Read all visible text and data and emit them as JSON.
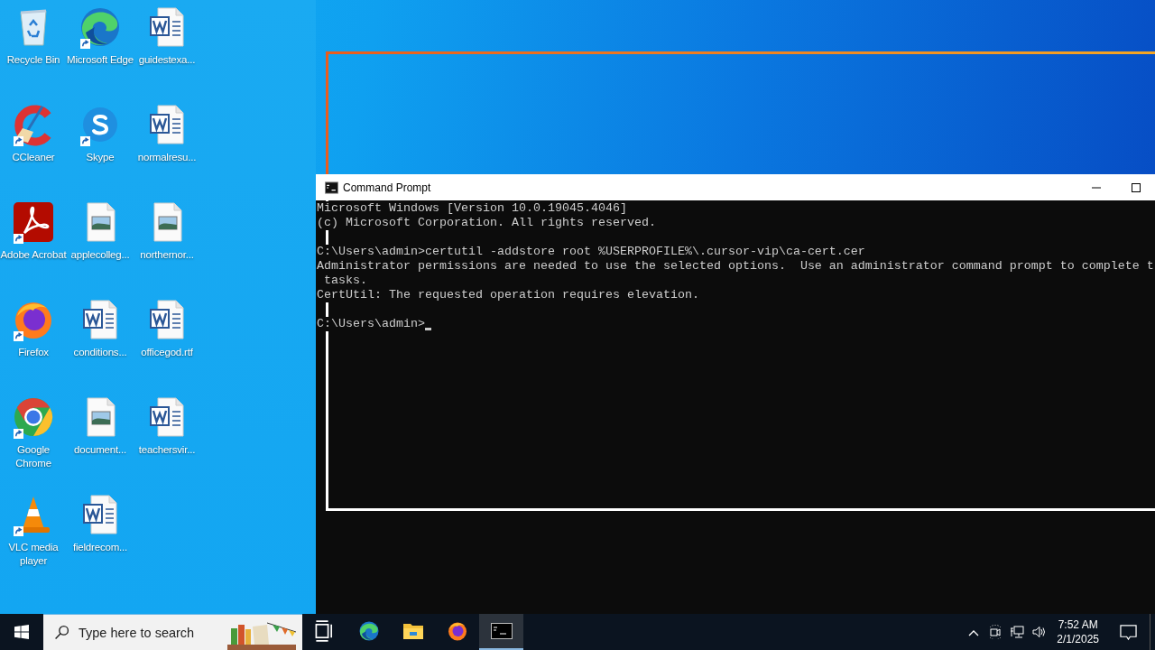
{
  "desktop": {
    "icons": [
      {
        "label": "Recycle Bin",
        "kind": "recycle-bin",
        "shortcut": false
      },
      {
        "label": "CCleaner",
        "kind": "ccleaner",
        "shortcut": true
      },
      {
        "label": "Adobe Acrobat",
        "kind": "acrobat",
        "shortcut": true
      },
      {
        "label": "Firefox",
        "kind": "firefox",
        "shortcut": true
      },
      {
        "label": "Google Chrome",
        "kind": "chrome",
        "shortcut": true
      },
      {
        "label": "VLC media player",
        "kind": "vlc",
        "shortcut": true
      },
      {
        "label": "Microsoft Edge",
        "kind": "edge",
        "shortcut": true
      },
      {
        "label": "Skype",
        "kind": "skype",
        "shortcut": true
      },
      {
        "label": "applecolleg...",
        "kind": "image-file",
        "shortcut": false
      },
      {
        "label": "conditions...",
        "kind": "word-file",
        "shortcut": false
      },
      {
        "label": "document...",
        "kind": "image-file",
        "shortcut": false
      },
      {
        "label": "fieldrecom...",
        "kind": "word-file",
        "shortcut": false
      },
      {
        "label": "guidestexa...",
        "kind": "word-file",
        "shortcut": false
      },
      {
        "label": "normalresu...",
        "kind": "word-file",
        "shortcut": false
      },
      {
        "label": "northernor...",
        "kind": "image-file",
        "shortcut": false
      },
      {
        "label": "officegod.rtf",
        "kind": "word-file",
        "shortcut": false
      },
      {
        "label": "teachersvir...",
        "kind": "word-file",
        "shortcut": false
      }
    ]
  },
  "console_window": {
    "title": "Command Prompt",
    "controls": [
      {
        "kind": "minimize"
      },
      {
        "kind": "maximize"
      }
    ],
    "blocks": [
      [
        "Microsoft Windows [Version 10.0.19045.4046]",
        "(c) Microsoft Corporation. All rights reserved."
      ],
      [
        "C:\\Users\\admin>certutil -addstore root %USERPROFILE%\\.cursor-vip\\ca-cert.cer",
        "Administrator permissions are needed to use the selected options.  Use an administrator command prompt to complete t",
        " tasks.",
        "CertUtil: The requested operation requires elevation."
      ],
      [
        "C:\\Users\\admin>"
      ]
    ]
  },
  "taskbar": {
    "search": {
      "placeholder": "Type here to search"
    },
    "apps": [
      {
        "kind": "task-view",
        "selected": false
      },
      {
        "kind": "edge",
        "selected": false
      },
      {
        "kind": "explorer",
        "selected": false
      },
      {
        "kind": "firefox",
        "selected": false
      },
      {
        "kind": "console",
        "selected": true
      }
    ],
    "tray": [
      {
        "kind": "chevron"
      },
      {
        "kind": "camera"
      },
      {
        "kind": "network"
      },
      {
        "kind": "volume"
      }
    ],
    "clock": {
      "time": "7:52 AM",
      "date": "2/1/2025"
    }
  }
}
